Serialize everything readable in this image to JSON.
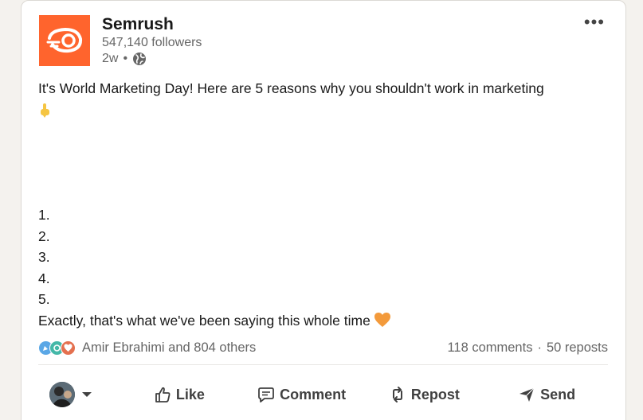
{
  "post": {
    "author": {
      "name": "Semrush",
      "followers": "547,140 followers",
      "time": "2w",
      "dot": "•"
    },
    "body": {
      "line1": "It's World Marketing Day! Here are 5 reasons why you shouldn't work in marketing",
      "list": [
        "1.",
        "2.",
        "3.",
        "4.",
        "5."
      ],
      "closing": "Exactly, that's what we've been saying this whole time"
    },
    "social": {
      "reactors": "Amir Ebrahimi and 804 others",
      "comments": "118 comments",
      "separator": "·",
      "reposts": "50 reposts"
    },
    "actions": {
      "like": "Like",
      "comment": "Comment",
      "repost": "Repost",
      "send": "Send"
    }
  },
  "colors": {
    "brand_orange": "#ff642d",
    "text_primary": "#191919",
    "text_secondary": "#666666",
    "action_text": "#404040",
    "background": "#f4f2ee"
  },
  "icons": [
    "semrush-logo",
    "globe-icon",
    "more-options-icon",
    "pointing-down-emoji",
    "orange-heart-emoji",
    "celebrate-reaction-icon",
    "support-reaction-icon",
    "love-reaction-icon",
    "chevron-down-icon",
    "like-icon",
    "comment-icon",
    "repost-icon",
    "send-icon"
  ]
}
